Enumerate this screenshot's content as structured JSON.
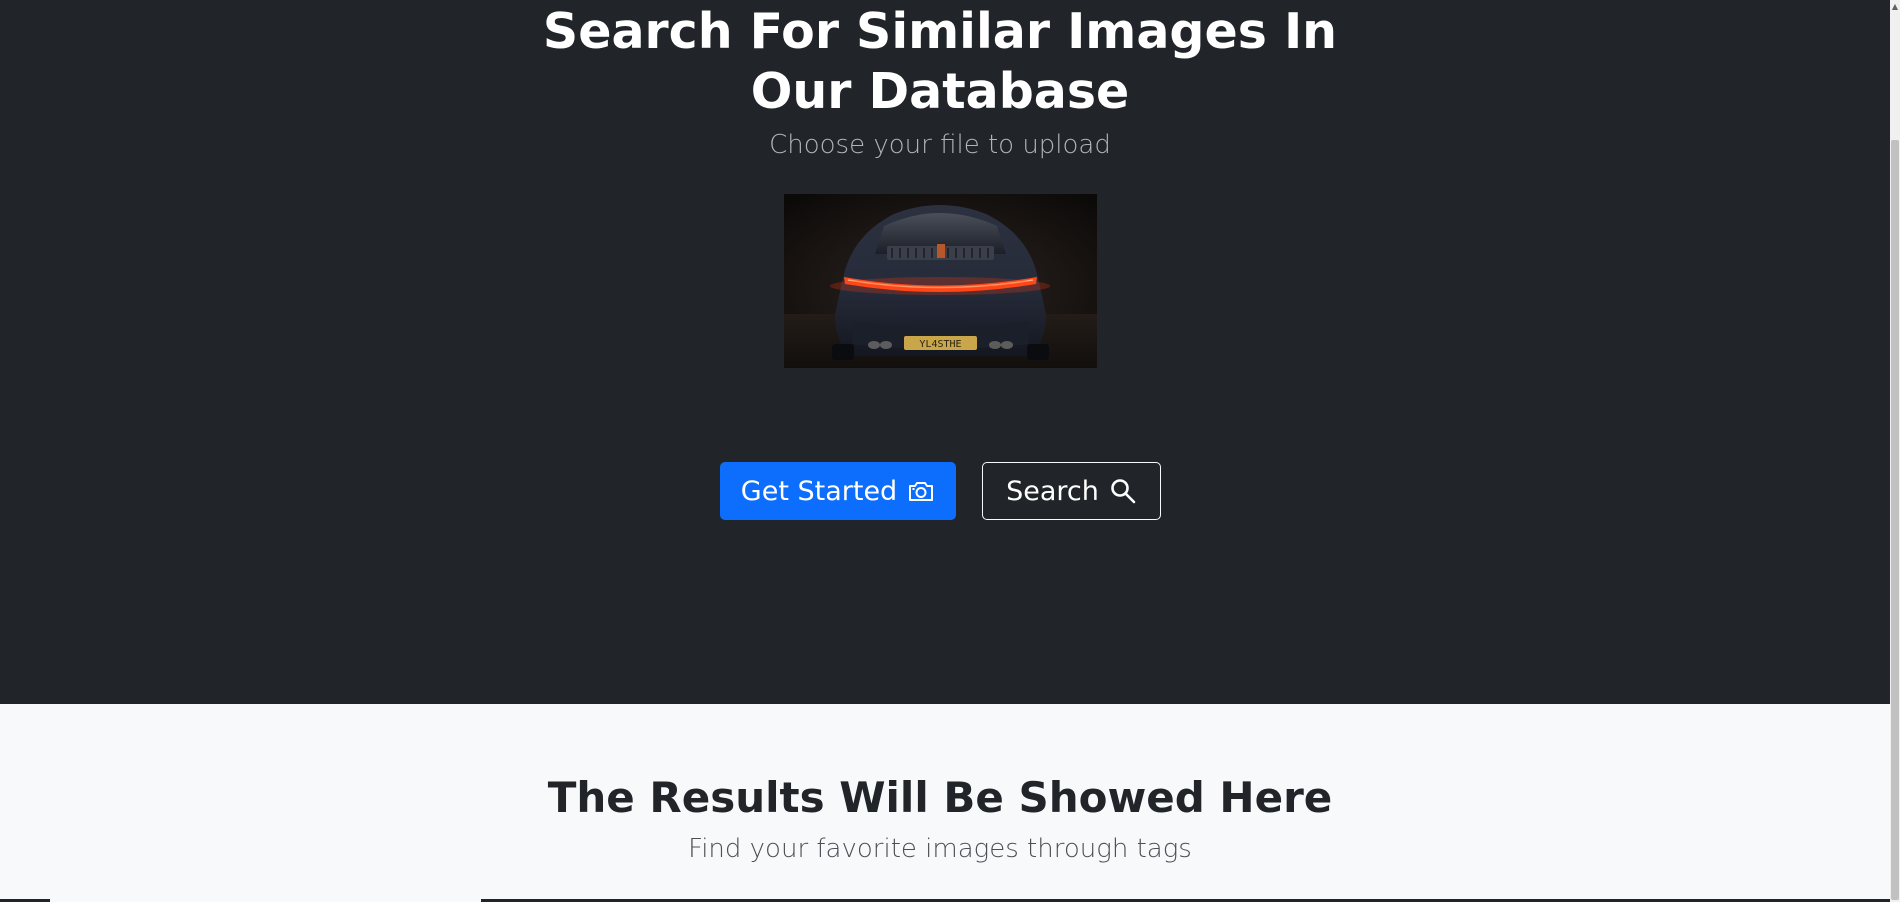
{
  "hero": {
    "title_line1": "Search For Similar Images In",
    "title_line2": "Our Database",
    "subtitle": "Choose your file to upload",
    "background_color": "#212529"
  },
  "preview_image": {
    "alt": "Rear view of a dark sports car with illuminated taillight bar",
    "plate_text": "YL4STHE"
  },
  "buttons": {
    "get_started": {
      "label": "Get Started",
      "icon": "camera-icon",
      "color": "#0d6efd"
    },
    "search": {
      "label": "Search",
      "icon": "search-icon"
    }
  },
  "results": {
    "title": "The Results Will Be Showed Here",
    "subtitle": "Find your favorite images through tags",
    "background_color": "#f8f9fa"
  }
}
